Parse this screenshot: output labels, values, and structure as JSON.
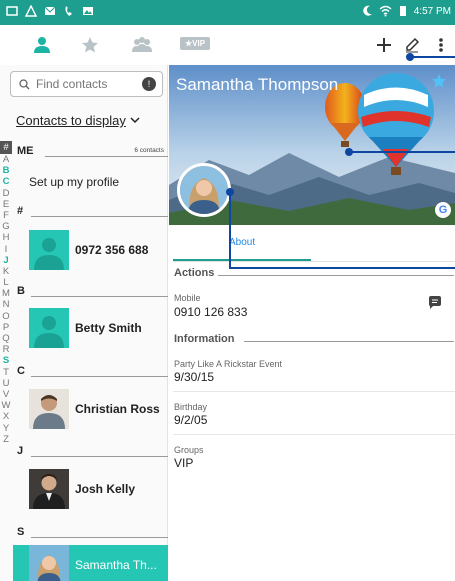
{
  "status_bar": {
    "time": "4:57 PM",
    "icons": [
      "notification-icon",
      "warning-icon",
      "mail-icon",
      "phone-icon",
      "photo-icon",
      "moon-icon",
      "wifi-icon",
      "battery-icon"
    ]
  },
  "toolbar": {
    "tabs": [
      "contacts-tab-person-icon",
      "favorites-tab-star-icon",
      "groups-tab-icon"
    ],
    "vip_label": "VIP",
    "actions": [
      "add-icon",
      "edit-icon",
      "more-icon"
    ]
  },
  "left_pane": {
    "search": {
      "placeholder": "Find contacts"
    },
    "display_filter": "Contacts to display",
    "index_letters": [
      "#",
      "A",
      "B",
      "C",
      "D",
      "E",
      "F",
      "G",
      "H",
      "I",
      "J",
      "K",
      "L",
      "M",
      "N",
      "O",
      "P",
      "Q",
      "R",
      "S",
      "T",
      "U",
      "V",
      "W",
      "X",
      "Y",
      "Z"
    ],
    "index_active": [
      "B",
      "C",
      "J",
      "S"
    ],
    "me_section": {
      "letter": "ME",
      "count": "6 contacts",
      "setup_label": "Set up my profile"
    },
    "sections": [
      {
        "letter": "#",
        "contacts": [
          {
            "name": "0972 356 688",
            "avatar": "placeholder"
          }
        ]
      },
      {
        "letter": "B",
        "contacts": [
          {
            "name": "Betty Smith",
            "avatar": "placeholder"
          }
        ]
      },
      {
        "letter": "C",
        "contacts": [
          {
            "name": "Christian Ross",
            "avatar": "photo"
          }
        ]
      },
      {
        "letter": "J",
        "contacts": [
          {
            "name": "Josh Kelly",
            "avatar": "photo"
          }
        ]
      },
      {
        "letter": "S",
        "contacts": [
          {
            "name": "Samantha Th...",
            "avatar": "photo",
            "selected": true
          }
        ]
      }
    ]
  },
  "detail": {
    "name": "Samantha Thompson",
    "tab": "About",
    "actions_title": "Actions",
    "mobile_label": "Mobile",
    "mobile_value": "0910 126 833",
    "information_title": "Information",
    "fields": [
      {
        "label": "Party Like A Rickstar Event",
        "value": "9/30/15"
      },
      {
        "label": "Birthday",
        "value": "9/2/05"
      },
      {
        "label": "Groups",
        "value": "VIP"
      }
    ],
    "google_badge": "G"
  },
  "colors": {
    "status_bar": "#1e9e8f",
    "accent": "#26c6b5",
    "accent_dark": "#1e9e8f",
    "callout_line": "#0d47a1",
    "tab_text": "#1e88e5"
  }
}
